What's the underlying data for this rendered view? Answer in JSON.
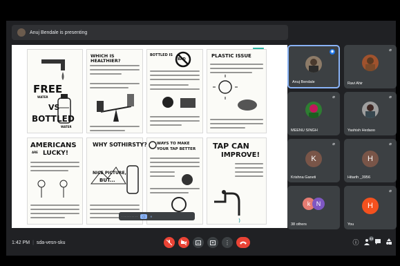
{
  "presenter_banner": {
    "text": "Anuj Bendale is presenting"
  },
  "comic_panels": [
    {
      "title_lines": [
        "FREE",
        "WATER"
      ],
      "subtitle_lines": [
        "VS",
        "BOTTLED",
        "WATER"
      ]
    },
    {
      "title_lines": [
        "WHICH IS HEALTHIER?"
      ]
    },
    {
      "title_lines": [
        "BOTTLED IS",
        "BAD"
      ]
    },
    {
      "title_lines": [
        "PLASTIC ISSUE"
      ]
    },
    {
      "title_lines": [
        "AMERICANS",
        "ARE",
        "LUCKY!"
      ]
    },
    {
      "title_lines": [
        "WHY SO",
        "THIRSTY?"
      ],
      "subtitle_lines": [
        "NICE PICTURE,",
        "BUT..."
      ]
    },
    {
      "title_lines": [
        "WAYS TO MAKE",
        "YOUR TAP BETTER"
      ]
    },
    {
      "title_lines": [
        "TAP CAN",
        "IMPROVE!"
      ]
    }
  ],
  "participants": [
    {
      "name": "Anuj Bendale",
      "speaking": true,
      "avatar": "photo"
    },
    {
      "name": "Ravi Ahir",
      "speaking": false,
      "avatar": "photo"
    },
    {
      "name": "MEENU SINGH",
      "speaking": false,
      "avatar": "photo"
    },
    {
      "name": "Yashish Hedaoo",
      "speaking": false,
      "avatar": "photo"
    },
    {
      "name": "Krishna Ganeti",
      "speaking": false,
      "initial": "K",
      "color": "#795548"
    },
    {
      "name": "Hitarth _3956",
      "speaking": false,
      "initial": "H",
      "color": "#795548"
    },
    {
      "name": "38 others",
      "initials": [
        "k",
        "N"
      ],
      "colors": [
        "#e67c73",
        "#7e57c2"
      ]
    },
    {
      "name": "You",
      "initial": "H",
      "color": "#f4511e"
    }
  ],
  "bottom_bar": {
    "time": "1:42 PM",
    "meeting_code": "sda-vesn-sku",
    "people_badge": "44",
    "controls": [
      "mic-off-icon",
      "camera-off-icon",
      "captions-icon",
      "present-icon",
      "more-icon",
      "end-call-icon"
    ],
    "right_icons": [
      "info-icon",
      "people-icon",
      "chat-icon",
      "activities-icon"
    ]
  },
  "colors": {
    "background": "#202124",
    "tile": "#3c4043",
    "red": "#ea4335",
    "active_border": "#8ab4f8"
  }
}
